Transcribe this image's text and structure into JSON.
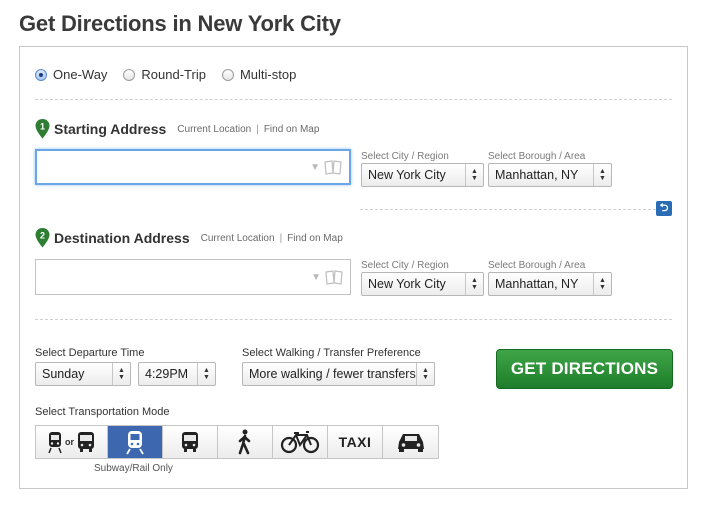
{
  "title": "Get Directions in New York City",
  "trip_type": {
    "options": [
      "One-Way",
      "Round-Trip",
      "Multi-stop"
    ],
    "selected": "One-Way"
  },
  "start": {
    "label": "Starting Address",
    "number": "1",
    "current_location": "Current Location",
    "separator": "|",
    "find_on_map": "Find on Map",
    "value": "",
    "city_label": "Select City / Region",
    "city_value": "New York City",
    "borough_label": "Select Borough / Area",
    "borough_value": "Manhattan, NY"
  },
  "destination": {
    "label": "Destination Address",
    "number": "2",
    "current_location": "Current Location",
    "separator": "|",
    "find_on_map": "Find on Map",
    "value": "",
    "city_label": "Select City / Region",
    "city_value": "New York City",
    "borough_label": "Select Borough / Area",
    "borough_value": "Manhattan, NY"
  },
  "departure": {
    "label": "Select Departure Time",
    "day": "Sunday",
    "time": "4:29PM"
  },
  "preference": {
    "label": "Select Walking / Transfer Preference",
    "value": "More walking / fewer transfers"
  },
  "get_directions_label": "GET DIRECTIONS",
  "transport": {
    "label": "Select Transportation Mode",
    "or_text": "or",
    "taxi_text": "TAXI",
    "selected_caption": "Subway/Rail Only",
    "modes": [
      "train-or-bus-icon",
      "subway-rail-icon",
      "bus-icon",
      "walk-icon",
      "bike-icon",
      "taxi",
      "car-icon"
    ],
    "active": "subway-rail-icon"
  },
  "colors": {
    "accent_blue": "#3d68b0",
    "green_button": "#2a8f35",
    "pin_green": "#2e7d32",
    "focus_blue": "#6aa6e8"
  }
}
